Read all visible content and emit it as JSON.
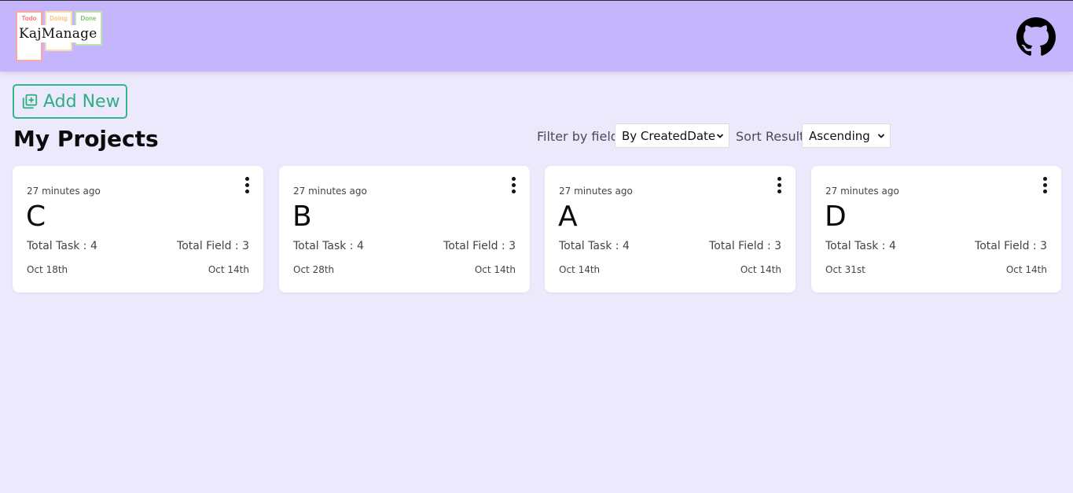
{
  "logo": {
    "columns": [
      "Todo",
      "Doing",
      "Done"
    ],
    "wordmark": "KajManage"
  },
  "header": {
    "github_icon": "github-icon"
  },
  "toolbar": {
    "add_label": "Add New"
  },
  "page": {
    "title": "My Projects"
  },
  "filter": {
    "label": "Filter by field",
    "value": "By CreatedDate",
    "sort_label": "Sort Result",
    "sort_value": "Ascending"
  },
  "projects": [
    {
      "ago": "27 minutes ago",
      "name": "C",
      "tasks": "Total Task : 4",
      "fields": "Total Field : 3",
      "date1": "Oct 18th",
      "date2": "Oct 14th"
    },
    {
      "ago": "27 minutes ago",
      "name": "B",
      "tasks": "Total Task : 4",
      "fields": "Total Field : 3",
      "date1": "Oct 28th",
      "date2": "Oct 14th"
    },
    {
      "ago": "27 minutes ago",
      "name": "A",
      "tasks": "Total Task : 4",
      "fields": "Total Field : 3",
      "date1": "Oct 14th",
      "date2": "Oct 14th"
    },
    {
      "ago": "27 minutes ago",
      "name": "D",
      "tasks": "Total Task : 4",
      "fields": "Total Field : 3",
      "date1": "Oct 31st",
      "date2": "Oct 14th"
    }
  ],
  "colors": {
    "header_bg": "#c4b5fd",
    "page_bg": "#ede9fd",
    "accent": "#34b58b"
  }
}
